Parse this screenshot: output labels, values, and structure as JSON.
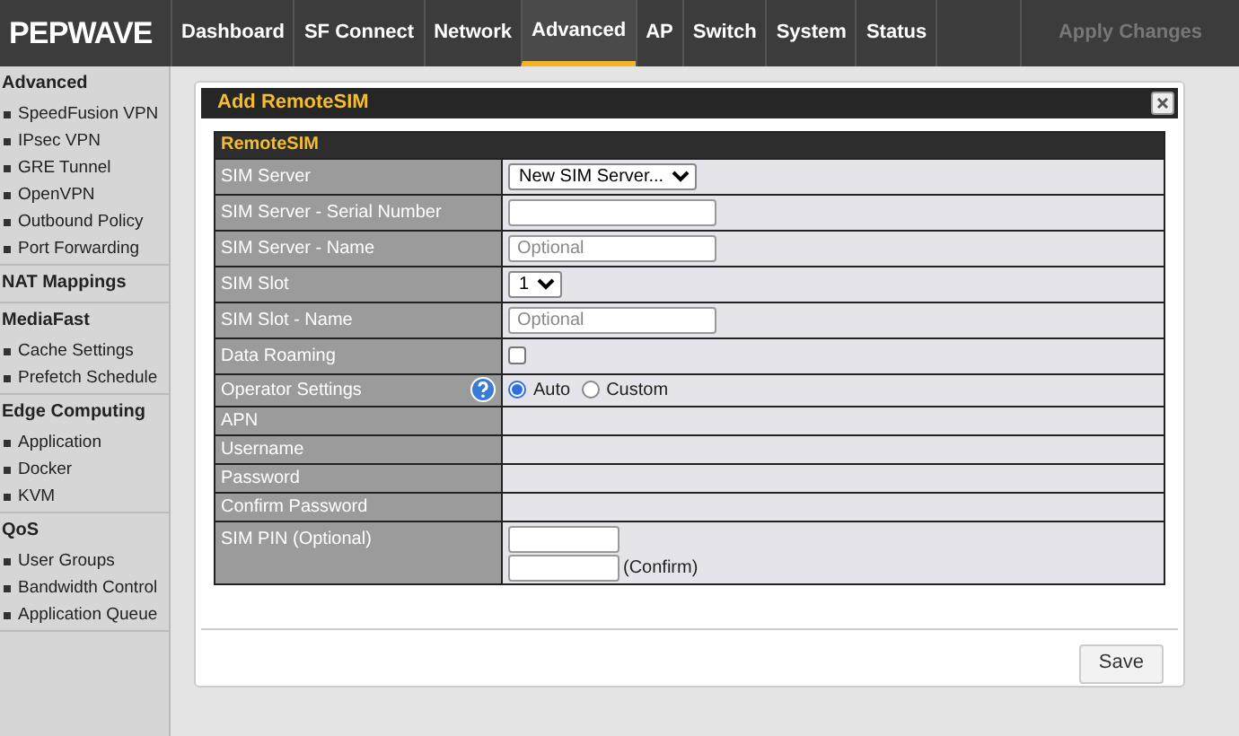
{
  "logo": "PEPWAVE",
  "nav": [
    {
      "label": "Dashboard",
      "selected": false
    },
    {
      "label": "SF Connect",
      "selected": false
    },
    {
      "label": "Network",
      "selected": false
    },
    {
      "label": "Advanced",
      "selected": true
    },
    {
      "label": "AP",
      "selected": false
    },
    {
      "label": "Switch",
      "selected": false
    },
    {
      "label": "System",
      "selected": false
    },
    {
      "label": "Status",
      "selected": false
    }
  ],
  "apply_button": {
    "label": "Apply Changes",
    "disabled": true
  },
  "sidebar": [
    {
      "title": "Advanced",
      "items": [
        "SpeedFusion VPN",
        "IPsec VPN",
        "GRE Tunnel",
        "OpenVPN",
        "Outbound Policy",
        "Port Forwarding"
      ]
    },
    {
      "title": "NAT Mappings"
    },
    {
      "title": "MediaFast",
      "items": [
        "Cache Settings",
        "Prefetch Schedule"
      ]
    },
    {
      "title": "Edge Computing",
      "items": [
        "Application",
        "Docker",
        "KVM"
      ]
    },
    {
      "title": "QoS",
      "items": [
        "User Groups",
        "Bandwidth Control",
        "Application Queue"
      ]
    }
  ],
  "dialog": {
    "title": "Add RemoteSIM",
    "section": "RemoteSIM",
    "rows": [
      {
        "label": "SIM Server",
        "kind": "select",
        "value": "New SIM Server..."
      },
      {
        "label": "SIM Server - Serial Number",
        "kind": "input"
      },
      {
        "label": "SIM Server - Name",
        "kind": "input",
        "placeholder": "Optional"
      },
      {
        "label": "SIM Slot",
        "kind": "select",
        "value": "1"
      },
      {
        "label": "SIM Slot - Name",
        "kind": "input",
        "placeholder": "Optional"
      },
      {
        "label": "Data Roaming",
        "kind": "checkbox",
        "checked": false
      },
      {
        "label": "Operator Settings",
        "kind": "radio",
        "help": true,
        "options": [
          {
            "label": "Auto",
            "selected": true
          },
          {
            "label": "Custom",
            "selected": false
          }
        ]
      },
      {
        "label": "APN",
        "kind": "empty"
      },
      {
        "label": "Username",
        "kind": "empty"
      },
      {
        "label": "Password",
        "kind": "empty"
      },
      {
        "label": "Confirm Password",
        "kind": "empty"
      },
      {
        "label": "SIM PIN (Optional)",
        "kind": "pin",
        "confirm_label": "(Confirm)"
      }
    ],
    "save_button": "Save"
  }
}
